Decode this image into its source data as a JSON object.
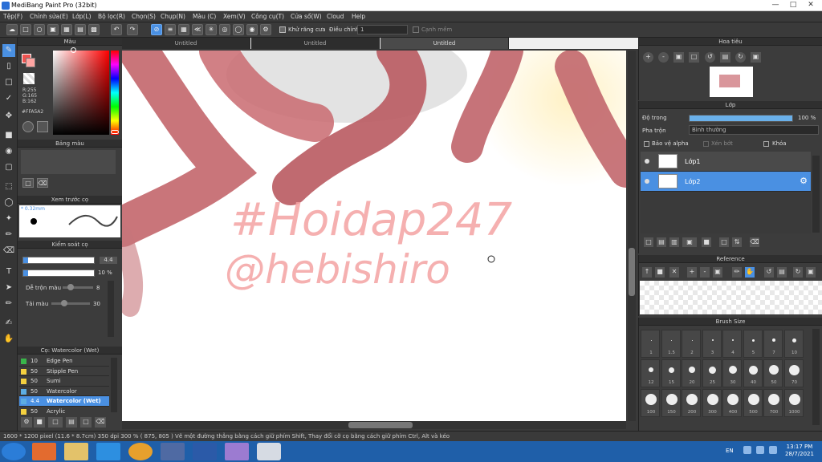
{
  "window": {
    "title": "MediBang Paint Pro (32bit)"
  },
  "menu": [
    "Tệp(F)",
    "Chỉnh sửa(E)",
    "Lớp(L)",
    "Bộ lọc(R)",
    "Chọn(S)",
    "Chụp(N)",
    "Màu (C)",
    "Xem(V)",
    "Công cụ(T)",
    "Cửa sổ(W)",
    "Cloud",
    "Help"
  ],
  "toolbar": {
    "antialias_label": "Khử răng cưa",
    "adjust_label": "Điều chỉnh",
    "adjust_value": "1",
    "smooth_label": "Cạnh mềm"
  },
  "tabs": [
    "Untitled",
    "Untitled",
    "Untitled"
  ],
  "color_panel": {
    "title": "Màu",
    "r": "R:255",
    "g": "G:165",
    "b": "B:162",
    "hex": "#FFA5A2",
    "primary": "#ef5350",
    "hue_pointer": "#ffa5a2"
  },
  "palette_panel": {
    "title": "Bảng màu"
  },
  "preview_panel": {
    "title": "Xem trước cọ",
    "size": "* 0.32mm"
  },
  "brush_control": {
    "title": "Kiểm soát cọ",
    "size_value": "4.4",
    "opacity_value": "10 %",
    "blend_label": "Dễ trộn màu",
    "blend_value": "8",
    "reload_label": "Tải màu",
    "reload_value": "30",
    "size_fill": 0.95,
    "opacity_fill": 0.95
  },
  "brush_list": {
    "title": "Cọ: Watercolor (Wet)",
    "items": [
      {
        "size": "10",
        "name": "Edge Pen",
        "color": "#39b54a"
      },
      {
        "size": "50",
        "name": "Stipple Pen",
        "color": "#f4d03f"
      },
      {
        "size": "50",
        "name": "Sumi",
        "color": "#f4d03f"
      },
      {
        "size": "50",
        "name": "Watercolor",
        "color": "#5dade2"
      },
      {
        "size": "4.4",
        "name": "Watercolor (Wet)",
        "color": "#5dade2"
      },
      {
        "size": "50",
        "name": "Acrylic",
        "color": "#f4d03f"
      }
    ]
  },
  "canvas": {
    "text_line1": "#Hoidap247",
    "text_line2": "@hebishiro"
  },
  "navigator": {
    "title": "Hoa tiêu"
  },
  "layer_panel": {
    "title": "Lớp",
    "opacity_label": "Độ trong",
    "opacity_value": "100 %",
    "blend_label": "Pha trộn",
    "blend_value": "Bình thường",
    "protect_alpha": "Bảo vệ alpha",
    "clip": "Xén bớt",
    "lock": "Khóa",
    "layers": [
      {
        "name": "Lớp1",
        "selected": false
      },
      {
        "name": "Lớp2",
        "selected": true
      }
    ]
  },
  "reference_panel": {
    "title": "Reference"
  },
  "brush_size_panel": {
    "title": "Brush Size",
    "row1": [
      "1",
      "1.5",
      "2",
      "3",
      "4",
      "5",
      "7",
      "10"
    ],
    "row2": [
      "12",
      "15",
      "20",
      "25",
      "30",
      "40",
      "50",
      "70"
    ],
    "row3": [
      "100",
      "150",
      "200",
      "300",
      "400",
      "500",
      "700",
      "1000"
    ]
  },
  "status": {
    "text": "1600 * 1200 pixel  (11.6 * 8.7cm)  350 dpi  300 %  ( 875, 805 )  Vẽ một đường thẳng bằng cách giữ phím Shift, Thay đổi cỡ cọ bằng cách giữ phím Ctrl, Alt và kéo"
  },
  "taskbar": {
    "lang": "EN",
    "time": "13:17 PM",
    "date": "28/7/2021"
  }
}
